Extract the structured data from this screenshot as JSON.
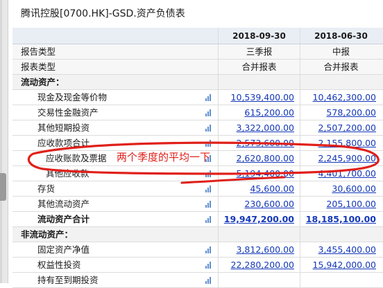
{
  "window": {
    "title": "腾讯控股[0700.HK]-GSD.资产负债表"
  },
  "table": {
    "columns": [
      "2018-09-30",
      "2018-06-30"
    ],
    "rows": [
      {
        "label": "报告类型",
        "values": [
          "三季报",
          "中报"
        ],
        "kind": "meta"
      },
      {
        "label": "报表类型",
        "values": [
          "合并报表",
          "合并报表"
        ],
        "kind": "meta"
      },
      {
        "label": "流动资产：",
        "values": [
          "",
          ""
        ],
        "kind": "section"
      },
      {
        "label": "现金及现金等价物",
        "values": [
          "10,539,400.00",
          "10,462,300.00"
        ],
        "kind": "item"
      },
      {
        "label": "交易性金融资产",
        "values": [
          "615,200.00",
          "578,200.00"
        ],
        "kind": "item"
      },
      {
        "label": "其他短期投资",
        "values": [
          "3,322,000.00",
          "2,507,200.00"
        ],
        "kind": "item"
      },
      {
        "label": "应收款项合计",
        "values": [
          "2,573,600.00",
          "2,155,800.00"
        ],
        "kind": "item"
      },
      {
        "label": "应收账款及票据",
        "values": [
          "2,620,800.00",
          "2,245,900.00"
        ],
        "kind": "subitem"
      },
      {
        "label": "其他应收款",
        "values": [
          "5,194,400.00",
          "4,401,700.00"
        ],
        "kind": "subitem"
      },
      {
        "label": "存货",
        "values": [
          "45,600.00",
          "30,600.00"
        ],
        "kind": "item"
      },
      {
        "label": "其他流动资产",
        "values": [
          "230,600.00",
          "205,100.00"
        ],
        "kind": "item"
      },
      {
        "label": "流动资产合计",
        "values": [
          "19,947,200.00",
          "18,185,100.00"
        ],
        "kind": "total"
      },
      {
        "label": "非流动资产：",
        "values": [
          "",
          ""
        ],
        "kind": "section"
      },
      {
        "label": "固定资产净值",
        "values": [
          "3,812,600.00",
          "3,455,400.00"
        ],
        "kind": "item"
      },
      {
        "label": "权益性投资",
        "values": [
          "22,280,200.00",
          "15,942,000.00"
        ],
        "kind": "item"
      },
      {
        "label": "持有至到期投资",
        "values": [
          "",
          ""
        ],
        "kind": "item"
      }
    ]
  },
  "annotation": {
    "text": "两个季度的平均一下",
    "color": "#e0201a"
  },
  "icons": {
    "row_chart": "bar-chart-icon"
  }
}
